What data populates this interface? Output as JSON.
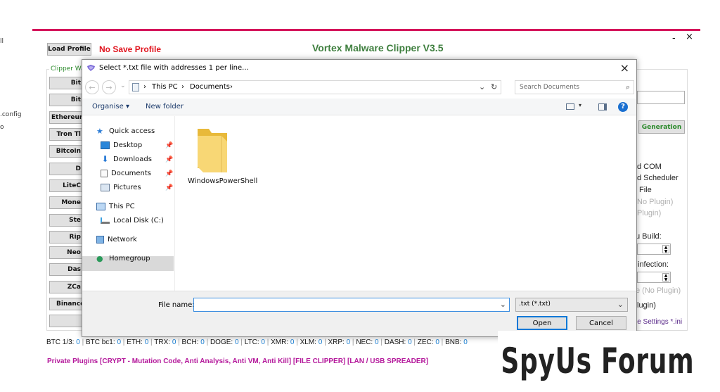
{
  "left_edge": [
    "ll",
    ".config",
    "o"
  ],
  "app": {
    "title": "Vortex Malware Clipper V3.5",
    "load_profile": "Load Profile",
    "no_save_profile": "No Save Profile",
    "group_label": "Clipper Wa",
    "minimize": "-",
    "close": "×",
    "left_buttons": [
      "Bit",
      "Bit",
      "Ethereum",
      "Tron Tl",
      "Bitcoin",
      "D",
      "LiteC",
      "Mone",
      "Ste",
      "Rip",
      "Neo",
      "Das",
      "ZCa",
      "Binance",
      ""
    ],
    "generation_button": "Generation",
    "right_texts": [
      "d COM",
      "d Scheduler",
      "File",
      "No Plugin)",
      "Plugin)",
      "u Build:",
      "infection:",
      "e (No Plugin)",
      "lugin)",
      "le Settings *.ini"
    ],
    "status_items": [
      {
        "label": "BTC 1/3:",
        "value": "0"
      },
      {
        "label": "BTC bc1:",
        "value": "0"
      },
      {
        "label": "ETH:",
        "value": "0"
      },
      {
        "label": "TRX:",
        "value": "0"
      },
      {
        "label": "BCH:",
        "value": "0"
      },
      {
        "label": "DOGE:",
        "value": "0"
      },
      {
        "label": "LTC:",
        "value": "0"
      },
      {
        "label": "XMR:",
        "value": "0"
      },
      {
        "label": "XLM:",
        "value": "0"
      },
      {
        "label": "XRP:",
        "value": "0"
      },
      {
        "label": "NEC:",
        "value": "0"
      },
      {
        "label": "DASH:",
        "value": "0"
      },
      {
        "label": "ZEC:",
        "value": "0"
      },
      {
        "label": "BNB:",
        "value": "0"
      }
    ],
    "plugins_text": "Private Plugins [CRYPT - Mutation Code, Anti Analysis, Anti VM, Anti Kill] [FILE CLIPPER] [LAN / USB SPREADER]"
  },
  "dialog": {
    "title": "Select *.txt file with addresses 1 per line...",
    "breadcrumb": [
      "This PC",
      "Documents"
    ],
    "search_placeholder": "Search Documents",
    "organise": "Organise ▾",
    "new_folder": "New folder",
    "nav": {
      "quick_access": "Quick access",
      "desktop": "Desktop",
      "downloads": "Downloads",
      "documents": "Documents",
      "pictures": "Pictures",
      "this_pc": "This PC",
      "local_disk": "Local Disk (C:)",
      "network": "Network",
      "homegroup": "Homegroup"
    },
    "folder_name": "WindowsPowerShell",
    "file_name_label": "File name:",
    "file_name_value": "",
    "file_type": ".txt (*.txt)",
    "open": "Open",
    "cancel": "Cancel"
  },
  "watermark": "SpyUs Forum",
  "colors": {
    "accent_bar": "#d4145a",
    "title_green": "#3f7f3f",
    "no_save_red": "#e0141e",
    "plugins_magenta": "#b4189b"
  }
}
